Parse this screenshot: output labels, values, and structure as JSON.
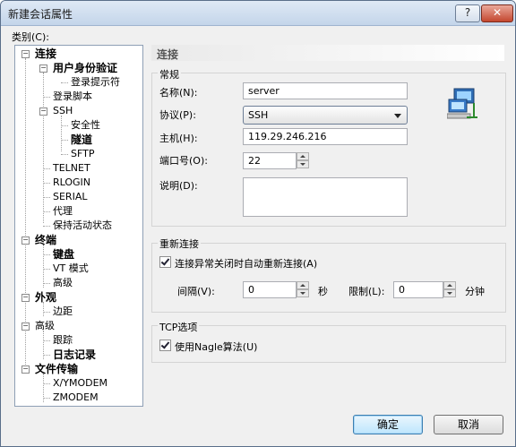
{
  "window": {
    "title": "新建会话属性"
  },
  "titlebar": {
    "help": "?",
    "close": "✕"
  },
  "category_label": "类别(C):",
  "tree": {
    "connection": "连接",
    "user_auth": "用户身份验证",
    "login_prompt": "登录提示符",
    "login_script": "登录脚本",
    "ssh": "SSH",
    "security": "安全性",
    "tunnel": "隧道",
    "sftp": "SFTP",
    "telnet": "TELNET",
    "rlogin": "RLOGIN",
    "serial": "SERIAL",
    "proxy": "代理",
    "keepalive": "保持活动状态",
    "terminal": "终端",
    "keyboard": "键盘",
    "vt_mode": "VT 模式",
    "term_advanced": "高级",
    "appearance": "外观",
    "margin": "边距",
    "advanced": "高级",
    "trace": "跟踪",
    "logging": "日志记录",
    "file_transfer": "文件传输",
    "xymodem": "X/YMODEM",
    "zmodem": "ZMODEM"
  },
  "panel": {
    "title": "连接"
  },
  "general": {
    "title": "常规",
    "name_label": "名称(N):",
    "name_value": "server",
    "protocol_label": "协议(P):",
    "protocol_value": "SSH",
    "host_label": "主机(H):",
    "host_value": "119.29.246.216",
    "port_label": "端口号(O):",
    "port_value": "22",
    "desc_label": "说明(D):",
    "desc_value": ""
  },
  "reconnect": {
    "title": "重新连接",
    "checkbox_label": "连接异常关闭时自动重新连接(A)",
    "interval_label": "间隔(V):",
    "interval_value": "0",
    "interval_unit": "秒",
    "limit_label": "限制(L):",
    "limit_value": "0",
    "limit_unit": "分钟"
  },
  "tcp": {
    "title": "TCP选项",
    "nagle_label": "使用Nagle算法(U)"
  },
  "buttons": {
    "ok": "确定",
    "cancel": "取消"
  }
}
